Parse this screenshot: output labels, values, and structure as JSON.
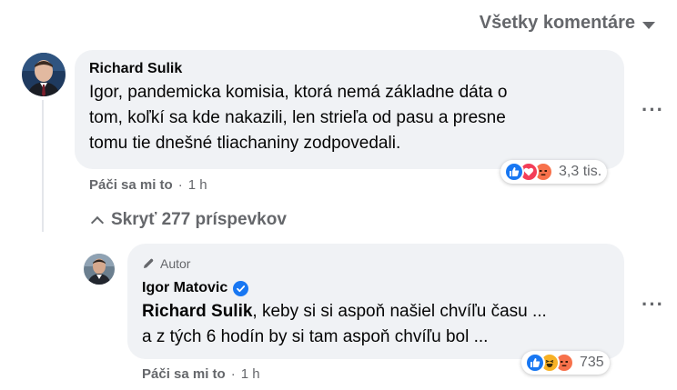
{
  "filter": {
    "label": "Všetky komentáre",
    "icon": "caret-down-icon"
  },
  "comment1": {
    "author": "Richard Sulik",
    "text_lines": [
      "Igor, pandemicka komisia, ktorá nemá základne dáta o",
      "tom, koľkí sa kde nakazili, len strieľa od pasu a presne",
      "tomu tie dnešné tliachaniny zodpovedali."
    ],
    "reactions": {
      "icons": [
        "like",
        "love",
        "angry"
      ],
      "count": "3,3 tis."
    },
    "meta": {
      "like": "Páči sa mi to",
      "sep": "·",
      "time": "1 h"
    }
  },
  "replies_toggle": {
    "label": "Skryť 277 príspevkov",
    "icon": "chevron-up-icon"
  },
  "reply1": {
    "badge": "Autor",
    "author": "Igor Matovic",
    "mention": "Richard Sulik",
    "text_line1_rest": ", keby si si aspoň našiel chvíľu času ...",
    "text_line2": "a z tých 6 hodín by si tam aspoň chvíľu bol ...",
    "reactions": {
      "icons": [
        "like",
        "haha",
        "angry"
      ],
      "count": "735"
    },
    "meta": {
      "like": "Páči sa mi to",
      "sep": "·",
      "time": "1 h"
    }
  },
  "colors": {
    "like": "#1877f2",
    "love": "#f33e58",
    "angry": "#f7714b",
    "haha": "#f7b125",
    "bubble": "#f0f2f5",
    "secondary_text": "#65676b"
  }
}
